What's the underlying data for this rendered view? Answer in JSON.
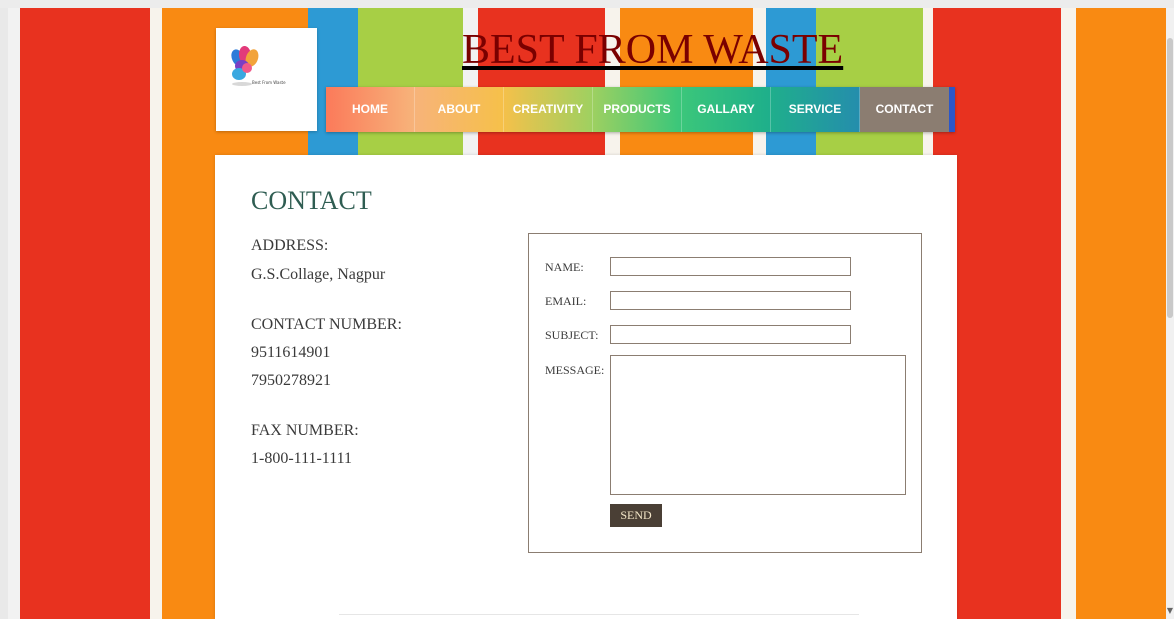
{
  "site": {
    "title": "BEST FROM WASTE",
    "logo_text": "Best From Waste"
  },
  "nav": {
    "items": [
      {
        "label": "HOME"
      },
      {
        "label": "ABOUT"
      },
      {
        "label": "CREATIVITY"
      },
      {
        "label": "PRODUCTS"
      },
      {
        "label": "GALLARY"
      },
      {
        "label": "SERVICE"
      },
      {
        "label": "CONTACT",
        "active": true
      }
    ]
  },
  "contact": {
    "heading": "CONTACT",
    "address_label": "ADDRESS:",
    "address_value": "G.S.Collage, Nagpur",
    "phone_label": "CONTACT NUMBER:",
    "phone_1": "9511614901",
    "phone_2": "7950278921",
    "fax_label": "FAX NUMBER:",
    "fax_value": "1-800-111-1111"
  },
  "form": {
    "name_label": "NAME:",
    "name_value": "",
    "email_label": "EMAIL:",
    "email_value": "",
    "subject_label": "SUBJECT:",
    "subject_value": "",
    "message_label": "MESSAGE:",
    "message_value": "",
    "send_label": "SEND"
  },
  "colors": {
    "title_text": "#7a0000",
    "heading": "#2f5d52",
    "active_nav": "#8b7d71",
    "send_button": "#4a3f35",
    "stripe_red": "#e8321f",
    "stripe_orange": "#f98a12",
    "stripe_blue": "#2d9ad4",
    "stripe_green": "#a7cf45"
  }
}
